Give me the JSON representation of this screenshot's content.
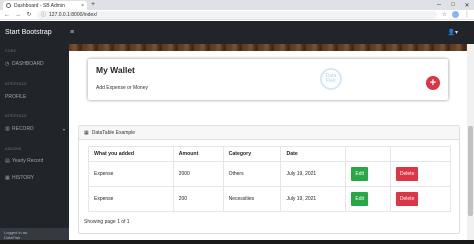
{
  "browser": {
    "tab_title": "Dashboard - SB Admin",
    "tab_close": "×",
    "new_tab": "+",
    "url": "127.0.0.1:8000/index/",
    "win_min": "─",
    "win_max": "□",
    "win_close": "✕"
  },
  "topnav": {
    "brand": "Start Bootstrap",
    "toggle_icon": "≡",
    "user_icon": "👤▾"
  },
  "sidebar": {
    "heading_core": "CORE",
    "item_dashboard": "DASHBOARD",
    "heading_interface": "INTERFACE",
    "item_profile": "PROFILE",
    "heading_interface2": "INTERFACE",
    "item_record": "RECORD",
    "heading_addons": "ADDONS",
    "item_yearly": "Yearly Record",
    "item_history": "HISTORY",
    "footer_line1": "Logged in as:",
    "footer_line2": "DataFlair"
  },
  "wallet": {
    "title": "My Wallet",
    "subtitle": "Add Expense or Money",
    "add_label": "+",
    "watermark": "Data Flair"
  },
  "table_card": {
    "header": "DataTable Example",
    "columns": [
      "What you added",
      "Amount",
      "Category",
      "Date",
      "",
      ""
    ],
    "rows": [
      {
        "what": "Expense",
        "amount": "2000",
        "category": "Others",
        "date": "July 19, 2021",
        "edit": "Edit",
        "delete": "Delete"
      },
      {
        "what": "Expense",
        "amount": "200",
        "category": "Necessities",
        "date": "July 19, 2021",
        "edit": "Edit",
        "delete": "Delete"
      }
    ],
    "paging": "Showing page 1 of 1"
  },
  "colors": {
    "nav_bg": "#212529",
    "accent_red": "#dc3545",
    "accent_green": "#28a745"
  }
}
